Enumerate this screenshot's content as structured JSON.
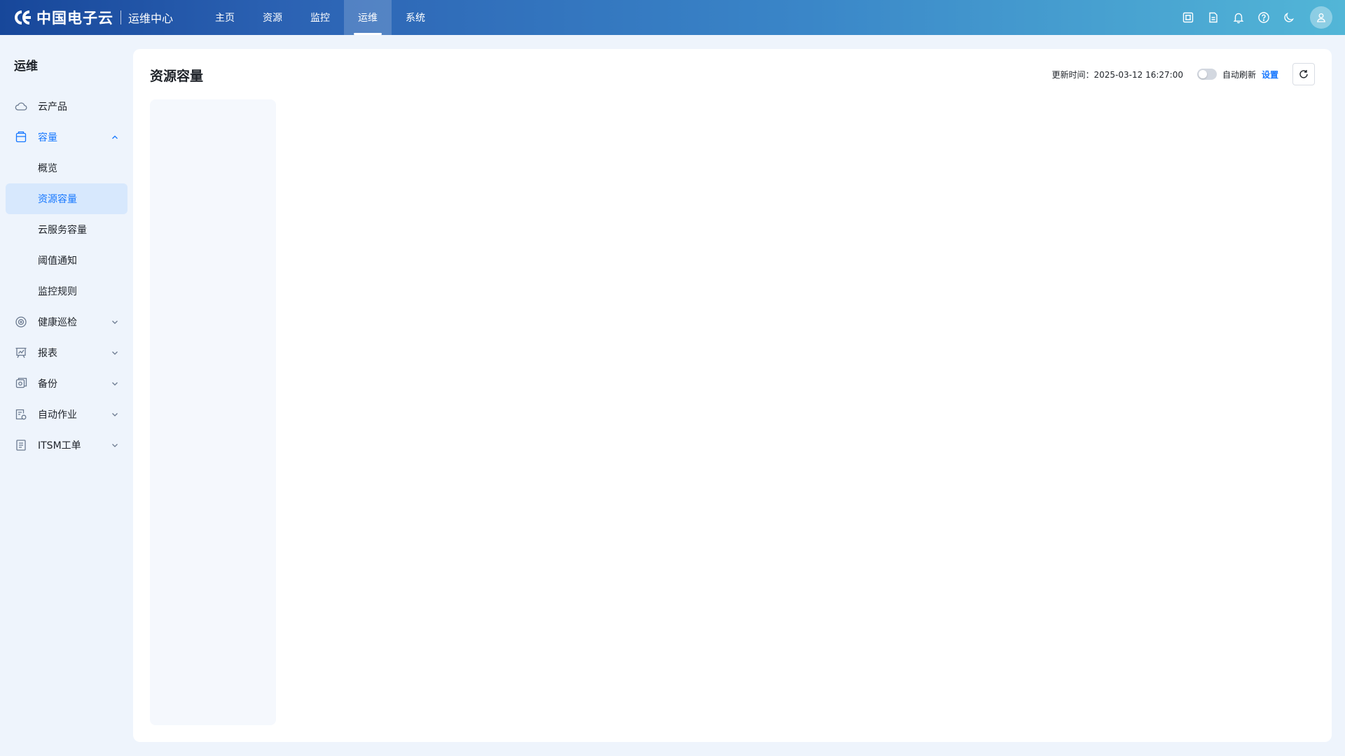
{
  "header": {
    "logo_text": "中国电子云",
    "subtitle": "运维中心",
    "nav": [
      {
        "label": "主页",
        "active": false
      },
      {
        "label": "资源",
        "active": false
      },
      {
        "label": "监控",
        "active": false
      },
      {
        "label": "运维",
        "active": true
      },
      {
        "label": "系统",
        "active": false
      }
    ],
    "icons": [
      "screen-icon",
      "document-icon",
      "bell-icon",
      "help-icon",
      "moon-icon",
      "user-avatar-icon"
    ]
  },
  "sidebar": {
    "title": "运维",
    "items": [
      {
        "label": "云产品",
        "icon": "cloud-icon"
      },
      {
        "label": "容量",
        "icon": "capacity-icon",
        "expanded": true,
        "children": [
          {
            "label": "概览",
            "active": false
          },
          {
            "label": "资源容量",
            "active": true
          },
          {
            "label": "云服务容量",
            "active": false
          },
          {
            "label": "阈值通知",
            "active": false
          },
          {
            "label": "监控规则",
            "active": false
          }
        ]
      },
      {
        "label": "健康巡检",
        "icon": "health-check-icon"
      },
      {
        "label": "报表",
        "icon": "report-icon"
      },
      {
        "label": "备份",
        "icon": "backup-icon"
      },
      {
        "label": "自动作业",
        "icon": "auto-job-icon"
      },
      {
        "label": "ITSM工单",
        "icon": "ticket-icon"
      }
    ]
  },
  "main": {
    "title": "资源容量",
    "update_time_label": "更新时间：2025-03-12 16:27:00",
    "auto_refresh_label": "自动刷新",
    "auto_refresh_on": false,
    "settings_label": "设置"
  },
  "colors": {
    "accent": "#1677ff",
    "active_bg": "#d7e8fd",
    "page_bg": "#eef4fc"
  }
}
